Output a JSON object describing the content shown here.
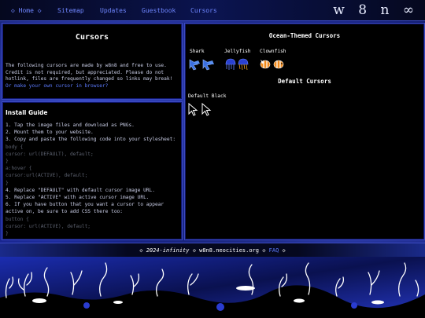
{
  "nav": {
    "items": [
      {
        "label": "◇ Home ◇"
      },
      {
        "label": "Sitemap"
      },
      {
        "label": "Updates"
      },
      {
        "label": "Guestbook"
      },
      {
        "label": "Cursors"
      }
    ],
    "brand": "w 8 n ∞"
  },
  "intro": {
    "title": "Cursors",
    "text": "The following cursors are made by w8n8 and free to use. Credit is not required, but appreciated. Please do not hotlink, files are frequently changed so links may break!",
    "link": "Or make your own cursor in browser?"
  },
  "guide": {
    "title": "Install Guide",
    "lines": [
      {
        "text": "1. Tap the image files and download as PNGs.",
        "code": false
      },
      {
        "text": "2. Mount them to your website.",
        "code": false
      },
      {
        "text": "3. Copy and paste the following code into your stylesheet:",
        "code": false
      },
      {
        "text": "body {",
        "code": true
      },
      {
        "text": "cursor: url(DEFAULT), default;",
        "code": true
      },
      {
        "text": "}",
        "code": true
      },
      {
        "text": "a:hover {",
        "code": true
      },
      {
        "text": "cursor:url(ACTIVE), default;",
        "code": true
      },
      {
        "text": "}",
        "code": true
      },
      {
        "text": "4. Replace \"DEFAULT\" with default cursor image URL.",
        "code": false
      },
      {
        "text": "5. Replace \"ACTIVE\" with active cursor image URL.",
        "code": false
      },
      {
        "text": "6. If you have button that you want a cursor to appear active on, be sure to add CSS there too:",
        "code": false
      },
      {
        "text": "button {",
        "code": true
      },
      {
        "text": "cursor: url(ACTIVE), default;",
        "code": true
      },
      {
        "text": "}",
        "code": true
      }
    ]
  },
  "ocean": {
    "title": "Ocean-Themed Cursors",
    "sets": [
      {
        "label": "Shark",
        "icon": "shark-cursor-icon",
        "color": "#3a6fe0"
      },
      {
        "label": "Jellyfish",
        "icon": "jellyfish-cursor-icon",
        "color": "#2a40d0"
      },
      {
        "label": "Clownfish",
        "icon": "clownfish-cursor-icon",
        "color": "#f08a1c"
      }
    ]
  },
  "default_cursors": {
    "title": "Default Cursors",
    "sets": [
      {
        "label": "Default Black",
        "icon": "arrow-cursor-icon"
      }
    ]
  },
  "footer": {
    "pre": "◇ ",
    "year": "2024-infinity",
    "mid": " ◇ w8n8.neocities.org ◇ ",
    "faq": "FAQ",
    "post": " ◇"
  },
  "colors": {
    "accent": "#5c7bff",
    "border": "#3b4ac0",
    "panel": "#000000"
  }
}
